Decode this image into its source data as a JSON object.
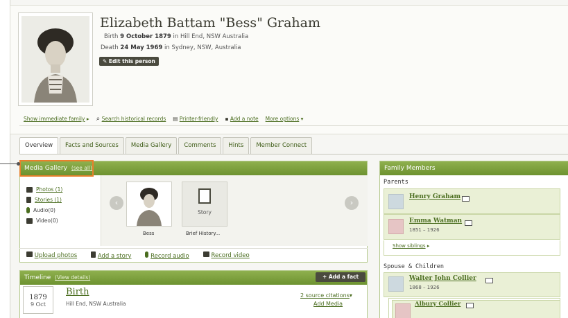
{
  "person": {
    "name": "Elizabeth Battam \"Bess\" Graham",
    "birth_label": "Birth",
    "birth_date": "9 October 1879",
    "birth_in": "in",
    "birth_place": "Hill End, NSW Australia",
    "death_label": "Death",
    "death_date": "24 May 1969",
    "death_in": "in",
    "death_place": "Sydney, NSW, Australia",
    "edit_label": "Edit this person"
  },
  "actions": {
    "show_family": "Show immediate family",
    "search_records": "Search historical records",
    "printer_friendly": "Printer-friendly",
    "add_note": "Add a note",
    "more_options": "More options"
  },
  "tabs": [
    {
      "label": "Overview"
    },
    {
      "label": "Facts and Sources"
    },
    {
      "label": "Media Gallery"
    },
    {
      "label": "Comments"
    },
    {
      "label": "Hints"
    },
    {
      "label": "Member Connect"
    }
  ],
  "media_gallery": {
    "title": "Media Gallery",
    "see_all": "(see all)",
    "items": [
      {
        "label": "Photos (1)",
        "icon": "camera-icon"
      },
      {
        "label": "Stories (1)",
        "icon": "document-icon"
      },
      {
        "label": "Audio(0)",
        "icon": "microphone-icon"
      },
      {
        "label": "Video(0)",
        "icon": "video-icon"
      }
    ],
    "thumbs": [
      {
        "caption": "Bess"
      },
      {
        "caption": "Brief History...",
        "story_label": "Story"
      }
    ],
    "bar": {
      "upload_photos": "Upload photos",
      "add_story": "Add a story",
      "record_audio": "Record audio",
      "record_video": "Record video"
    }
  },
  "timeline": {
    "title": "Timeline",
    "view_details": "(View details)",
    "add_fact": "Add a fact",
    "event": {
      "year": "1879",
      "date": "9 Oct",
      "title": "Birth",
      "place": "Hill End, NSW Australia",
      "citations": "2 source citations",
      "add_media": "Add Media"
    }
  },
  "family": {
    "title": "Family Members",
    "parents_label": "Parents",
    "parents": [
      {
        "name": "Henry Graham",
        "years": ""
      },
      {
        "name": "Emma Watman",
        "years": "1851 – 1926"
      }
    ],
    "show_siblings": "Show siblings",
    "spouse_label": "Spouse & Children",
    "spouse": {
      "name": "Walter John Collier",
      "years": "1868 – 1926"
    },
    "child": {
      "name": "Albury Collier"
    }
  },
  "colors": {
    "accent_green": "#6d9230",
    "link_green": "#4a6d1f",
    "callout_orange": "#e8802c"
  }
}
